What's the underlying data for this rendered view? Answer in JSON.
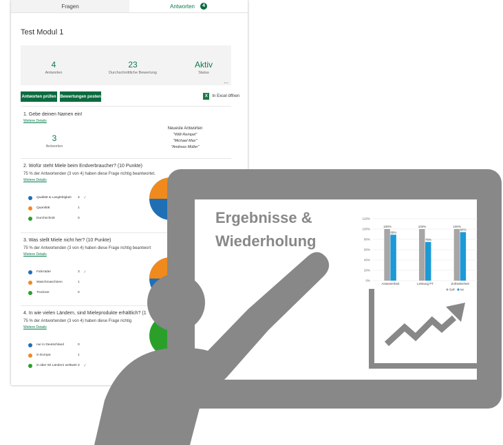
{
  "tabs": [
    {
      "label": "Fragen"
    },
    {
      "label": "Antworten",
      "badge": "4"
    }
  ],
  "form": {
    "title": "Test Modul 1"
  },
  "stats": [
    {
      "value": "4",
      "label": "Antworten"
    },
    {
      "value": "23",
      "label": "Durchschnittliche Bewertung"
    },
    {
      "value": "Aktiv",
      "label": "Status"
    }
  ],
  "more_label": "...",
  "buttons": {
    "review": "Antworten prüfen",
    "post": "Bewertungen posten",
    "excel": "In Excel öffnen",
    "excel_icon": "X"
  },
  "q1": {
    "title": "1.  Gebe deinen Namen ein!",
    "details": "Weitere Details",
    "count": "3",
    "count_label": "Antworten",
    "latest_label": "Neueste Antworten",
    "names": [
      "\"Willi Rempel\"",
      "\"Michael Max\"",
      "\"Andreas Müller\""
    ]
  },
  "q2": {
    "title": "2.  Wofür steht Miele beim Endverbraucher? (10 Punkte)",
    "sub": "75 % der Antwortenden (3 von 4) haben diese Frage richtig beantwortet.",
    "details": "Weitere Details",
    "options": [
      {
        "label": "Qualität & Langlebigkeit",
        "count": "3",
        "check": "✓",
        "color": "#1f6fb5"
      },
      {
        "label": "Quantität",
        "count": "1",
        "check": "",
        "color": "#f08a1c"
      },
      {
        "label": "Durchschnitt",
        "count": "0",
        "check": "",
        "color": "#2aa02a"
      }
    ]
  },
  "q3": {
    "title": "3.  Was stellt Miele nicht her? (10 Punkte)",
    "sub": "75 % der Antwortenden (3 von 4) haben diese Frage richtig beantwort",
    "details": "Weitere Details",
    "options": [
      {
        "label": "Fahrräder",
        "count": "3",
        "check": "✓",
        "color": "#1f6fb5"
      },
      {
        "label": "Waschmaschinen",
        "count": "1",
        "check": "",
        "color": "#f08a1c"
      },
      {
        "label": "Trockner",
        "count": "0",
        "check": "",
        "color": "#2aa02a"
      }
    ]
  },
  "q4": {
    "title": "4.  In wie vielen Ländern, sind Mieleprodukte erhältlich? (1",
    "sub": "75 % der Antwortenden (3 von 4) haben diese Frage richtig",
    "details": "Weitere Details",
    "options": [
      {
        "label": "nur in Deutschland",
        "count": "0",
        "check": "",
        "color": "#1f6fb5"
      },
      {
        "label": "in Europa",
        "count": "1",
        "check": "",
        "color": "#f08a1c"
      },
      {
        "label": "in über 50 Ländern weltweit",
        "count": "3",
        "check": "✓",
        "color": "#2aa02a"
      }
    ]
  },
  "board": {
    "title_line1": "Ergebnisse &",
    "title_line2": "Wiederholung"
  },
  "colors": {
    "forms_green": "#0b6a3f",
    "board_gray": "#888888",
    "bar_gray": "#a6a6a6",
    "bar_blue": "#1c9ad6"
  },
  "chart_data": {
    "type": "bar",
    "categories": [
      "Anwesenheit",
      "Leistung PT",
      "Zufriedenheit"
    ],
    "series": [
      {
        "name": "Soll",
        "values": [
          100,
          100,
          100
        ]
      },
      {
        "name": "Ist",
        "values": [
          89,
          75,
          94
        ]
      }
    ],
    "data_labels": [
      [
        "100%",
        "89%"
      ],
      [
        "100%",
        "75%"
      ],
      [
        "100%",
        "94%"
      ]
    ],
    "ylim": [
      0,
      120
    ],
    "yticks": [
      "0%",
      "20%",
      "40%",
      "60%",
      "80%",
      "100%",
      "120%"
    ],
    "legend": "bottom-right"
  }
}
